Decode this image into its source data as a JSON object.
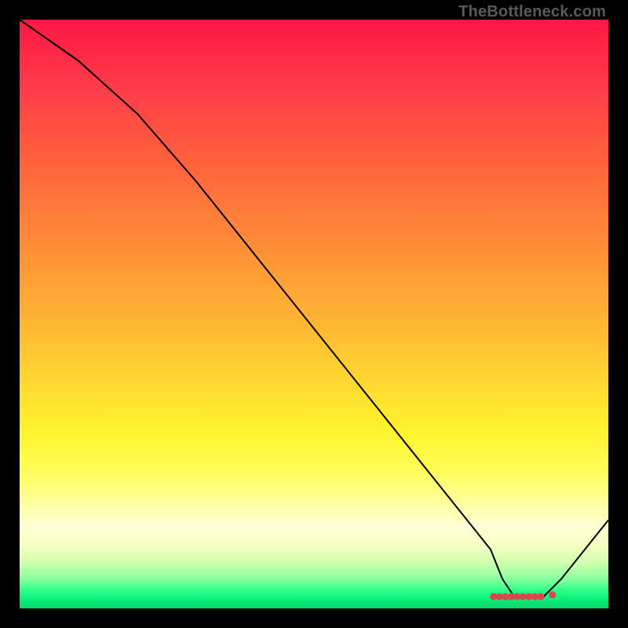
{
  "watermark": "TheBottleneck.com",
  "chart_data": {
    "type": "line",
    "title": "",
    "xlabel": "",
    "ylabel": "",
    "xlim": [
      0,
      100
    ],
    "ylim": [
      0,
      100
    ],
    "grid": false,
    "series": [
      {
        "name": "curve",
        "x": [
          0,
          10,
          20,
          30,
          40,
          50,
          60,
          70,
          80,
          82,
          84,
          89,
          92,
          100
        ],
        "values": [
          100,
          93,
          84,
          72.5,
          60,
          47.5,
          35,
          22.5,
          10,
          5,
          2,
          2,
          5,
          15
        ],
        "color": "#000000",
        "linewidth": 2
      },
      {
        "name": "markers",
        "x": [
          80.5,
          81.5,
          82.5,
          83.5,
          84.5,
          85.5,
          86.5,
          87.5,
          88.5,
          90.5
        ],
        "values": [
          2.0,
          2.0,
          2.0,
          2.0,
          2.0,
          2.0,
          2.0,
          2.0,
          2.0,
          2.3
        ],
        "color": "#d84a4a",
        "marker": "circle",
        "size": 4.5
      }
    ]
  }
}
